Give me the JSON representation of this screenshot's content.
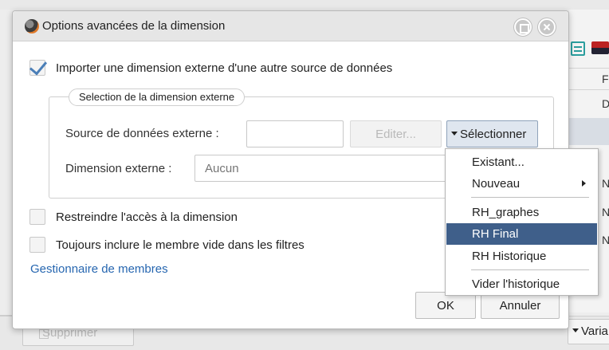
{
  "background": {
    "col_letters": [
      "F",
      "D"
    ],
    "row_letters": [
      "N",
      "N",
      "N"
    ],
    "delete_label": "Supprimer",
    "vari_label": "Varia"
  },
  "dialog": {
    "title": "Options avancées de la dimension",
    "import_checkbox_label": "Importer une dimension externe d'une autre source de données",
    "import_checked": true,
    "fieldset_legend": "Selection de la dimension externe",
    "source_label": "Source de données externe :",
    "source_value": "",
    "edit_button": "Editer...",
    "select_button": "Sélectionner",
    "dimension_label": "Dimension externe :",
    "dimension_placeholder": "Aucun",
    "restrict_label": "Restreindre l'accès à la dimension",
    "restrict_checked": false,
    "include_empty_label": "Toujours inclure le membre vide dans les filtres",
    "include_empty_checked": false,
    "members_manager_link": "Gestionnaire de membres",
    "ok_button": "OK",
    "cancel_button": "Annuler"
  },
  "menu": {
    "existing": "Existant...",
    "new": "Nouveau",
    "items": [
      "RH_graphes",
      "RH Final",
      "RH Historique"
    ],
    "active_item": "RH Final",
    "clear_history": "Vider l'historique"
  },
  "colors": {
    "accent": "#3f5f8a",
    "link": "#2666b0",
    "checkmark": "#4b7fb8"
  }
}
